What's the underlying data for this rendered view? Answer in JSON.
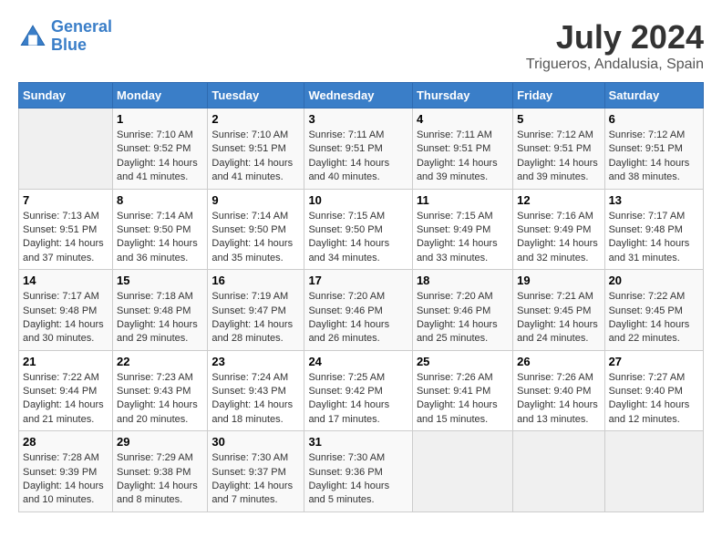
{
  "logo": {
    "line1": "General",
    "line2": "Blue"
  },
  "title": "July 2024",
  "subtitle": "Trigueros, Andalusia, Spain",
  "header": {
    "days": [
      "Sunday",
      "Monday",
      "Tuesday",
      "Wednesday",
      "Thursday",
      "Friday",
      "Saturday"
    ]
  },
  "weeks": [
    {
      "days": [
        {
          "num": "",
          "sunrise": "",
          "sunset": "",
          "daylight": ""
        },
        {
          "num": "1",
          "sunrise": "Sunrise: 7:10 AM",
          "sunset": "Sunset: 9:52 PM",
          "daylight": "Daylight: 14 hours and 41 minutes."
        },
        {
          "num": "2",
          "sunrise": "Sunrise: 7:10 AM",
          "sunset": "Sunset: 9:51 PM",
          "daylight": "Daylight: 14 hours and 41 minutes."
        },
        {
          "num": "3",
          "sunrise": "Sunrise: 7:11 AM",
          "sunset": "Sunset: 9:51 PM",
          "daylight": "Daylight: 14 hours and 40 minutes."
        },
        {
          "num": "4",
          "sunrise": "Sunrise: 7:11 AM",
          "sunset": "Sunset: 9:51 PM",
          "daylight": "Daylight: 14 hours and 39 minutes."
        },
        {
          "num": "5",
          "sunrise": "Sunrise: 7:12 AM",
          "sunset": "Sunset: 9:51 PM",
          "daylight": "Daylight: 14 hours and 39 minutes."
        },
        {
          "num": "6",
          "sunrise": "Sunrise: 7:12 AM",
          "sunset": "Sunset: 9:51 PM",
          "daylight": "Daylight: 14 hours and 38 minutes."
        }
      ]
    },
    {
      "days": [
        {
          "num": "7",
          "sunrise": "Sunrise: 7:13 AM",
          "sunset": "Sunset: 9:51 PM",
          "daylight": "Daylight: 14 hours and 37 minutes."
        },
        {
          "num": "8",
          "sunrise": "Sunrise: 7:14 AM",
          "sunset": "Sunset: 9:50 PM",
          "daylight": "Daylight: 14 hours and 36 minutes."
        },
        {
          "num": "9",
          "sunrise": "Sunrise: 7:14 AM",
          "sunset": "Sunset: 9:50 PM",
          "daylight": "Daylight: 14 hours and 35 minutes."
        },
        {
          "num": "10",
          "sunrise": "Sunrise: 7:15 AM",
          "sunset": "Sunset: 9:50 PM",
          "daylight": "Daylight: 14 hours and 34 minutes."
        },
        {
          "num": "11",
          "sunrise": "Sunrise: 7:15 AM",
          "sunset": "Sunset: 9:49 PM",
          "daylight": "Daylight: 14 hours and 33 minutes."
        },
        {
          "num": "12",
          "sunrise": "Sunrise: 7:16 AM",
          "sunset": "Sunset: 9:49 PM",
          "daylight": "Daylight: 14 hours and 32 minutes."
        },
        {
          "num": "13",
          "sunrise": "Sunrise: 7:17 AM",
          "sunset": "Sunset: 9:48 PM",
          "daylight": "Daylight: 14 hours and 31 minutes."
        }
      ]
    },
    {
      "days": [
        {
          "num": "14",
          "sunrise": "Sunrise: 7:17 AM",
          "sunset": "Sunset: 9:48 PM",
          "daylight": "Daylight: 14 hours and 30 minutes."
        },
        {
          "num": "15",
          "sunrise": "Sunrise: 7:18 AM",
          "sunset": "Sunset: 9:48 PM",
          "daylight": "Daylight: 14 hours and 29 minutes."
        },
        {
          "num": "16",
          "sunrise": "Sunrise: 7:19 AM",
          "sunset": "Sunset: 9:47 PM",
          "daylight": "Daylight: 14 hours and 28 minutes."
        },
        {
          "num": "17",
          "sunrise": "Sunrise: 7:20 AM",
          "sunset": "Sunset: 9:46 PM",
          "daylight": "Daylight: 14 hours and 26 minutes."
        },
        {
          "num": "18",
          "sunrise": "Sunrise: 7:20 AM",
          "sunset": "Sunset: 9:46 PM",
          "daylight": "Daylight: 14 hours and 25 minutes."
        },
        {
          "num": "19",
          "sunrise": "Sunrise: 7:21 AM",
          "sunset": "Sunset: 9:45 PM",
          "daylight": "Daylight: 14 hours and 24 minutes."
        },
        {
          "num": "20",
          "sunrise": "Sunrise: 7:22 AM",
          "sunset": "Sunset: 9:45 PM",
          "daylight": "Daylight: 14 hours and 22 minutes."
        }
      ]
    },
    {
      "days": [
        {
          "num": "21",
          "sunrise": "Sunrise: 7:22 AM",
          "sunset": "Sunset: 9:44 PM",
          "daylight": "Daylight: 14 hours and 21 minutes."
        },
        {
          "num": "22",
          "sunrise": "Sunrise: 7:23 AM",
          "sunset": "Sunset: 9:43 PM",
          "daylight": "Daylight: 14 hours and 20 minutes."
        },
        {
          "num": "23",
          "sunrise": "Sunrise: 7:24 AM",
          "sunset": "Sunset: 9:43 PM",
          "daylight": "Daylight: 14 hours and 18 minutes."
        },
        {
          "num": "24",
          "sunrise": "Sunrise: 7:25 AM",
          "sunset": "Sunset: 9:42 PM",
          "daylight": "Daylight: 14 hours and 17 minutes."
        },
        {
          "num": "25",
          "sunrise": "Sunrise: 7:26 AM",
          "sunset": "Sunset: 9:41 PM",
          "daylight": "Daylight: 14 hours and 15 minutes."
        },
        {
          "num": "26",
          "sunrise": "Sunrise: 7:26 AM",
          "sunset": "Sunset: 9:40 PM",
          "daylight": "Daylight: 14 hours and 13 minutes."
        },
        {
          "num": "27",
          "sunrise": "Sunrise: 7:27 AM",
          "sunset": "Sunset: 9:40 PM",
          "daylight": "Daylight: 14 hours and 12 minutes."
        }
      ]
    },
    {
      "days": [
        {
          "num": "28",
          "sunrise": "Sunrise: 7:28 AM",
          "sunset": "Sunset: 9:39 PM",
          "daylight": "Daylight: 14 hours and 10 minutes."
        },
        {
          "num": "29",
          "sunrise": "Sunrise: 7:29 AM",
          "sunset": "Sunset: 9:38 PM",
          "daylight": "Daylight: 14 hours and 8 minutes."
        },
        {
          "num": "30",
          "sunrise": "Sunrise: 7:30 AM",
          "sunset": "Sunset: 9:37 PM",
          "daylight": "Daylight: 14 hours and 7 minutes."
        },
        {
          "num": "31",
          "sunrise": "Sunrise: 7:30 AM",
          "sunset": "Sunset: 9:36 PM",
          "daylight": "Daylight: 14 hours and 5 minutes."
        },
        {
          "num": "",
          "sunrise": "",
          "sunset": "",
          "daylight": ""
        },
        {
          "num": "",
          "sunrise": "",
          "sunset": "",
          "daylight": ""
        },
        {
          "num": "",
          "sunrise": "",
          "sunset": "",
          "daylight": ""
        }
      ]
    }
  ]
}
